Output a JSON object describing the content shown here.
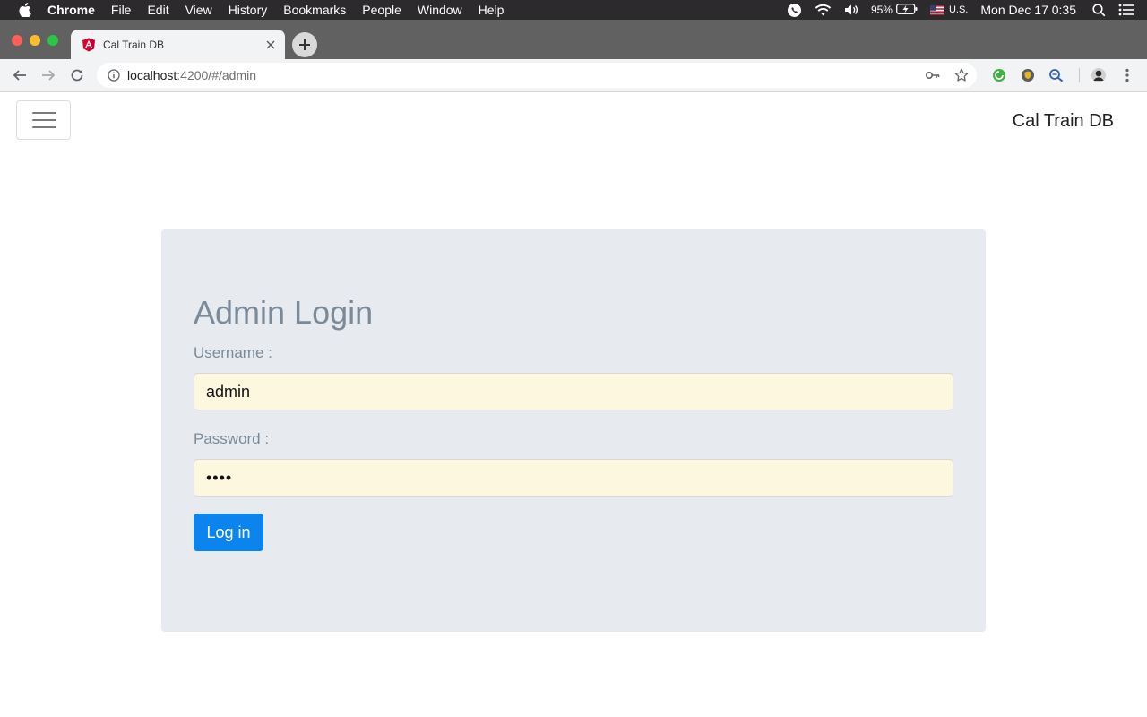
{
  "menubar": {
    "app_name": "Chrome",
    "menus": [
      "File",
      "Edit",
      "View",
      "History",
      "Bookmarks",
      "People",
      "Window",
      "Help"
    ],
    "battery": "95%",
    "input_source": "U.S.",
    "clock": "Mon Dec 17  0:35"
  },
  "browser": {
    "tab_title": "Cal Train DB",
    "url_host": "localhost",
    "url_path": ":4200/#/admin"
  },
  "navbar": {
    "brand": "Cal Train DB"
  },
  "login": {
    "title": "Admin Login",
    "username_label": "Username :",
    "username_value": "admin",
    "password_label": "Password :",
    "password_value": "••••",
    "submit_label": "Log in"
  },
  "colors": {
    "panel_bg": "#e7eaee",
    "input_autofill_bg": "#fdf7e0",
    "button_primary": "#0b84ed",
    "label_text": "#7b8a99"
  }
}
